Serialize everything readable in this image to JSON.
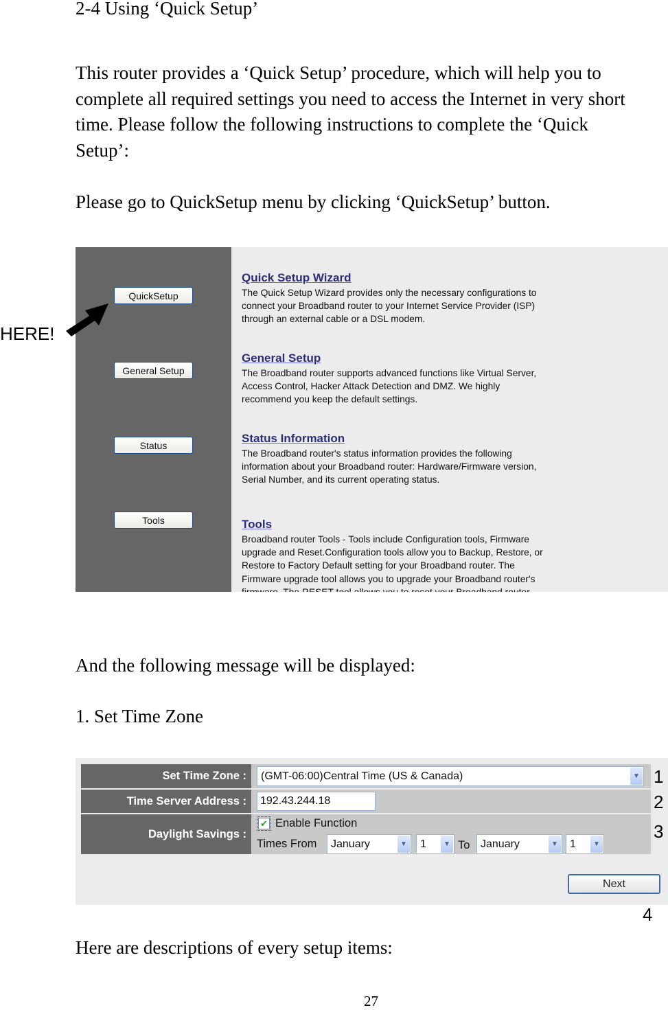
{
  "document": {
    "heading": "2-4 Using ‘Quick Setup’",
    "intro_lines": [
      "This router provides a ‘Quick Setup’ procedure, which will help you to",
      "complete all required settings you need to access the Internet in very short",
      "time. Please follow the following instructions to complete the ‘Quick",
      "Setup’:"
    ],
    "instruction": "Please go to QuickSetup menu by clicking ‘QuickSetup’ button.",
    "message_intro": "And the following message will be displayed:",
    "step_title": "1. Set Time Zone",
    "descriptions_intro": "Here are descriptions of every setup items:",
    "page_number": "27"
  },
  "annotation": {
    "here_label": "HERE!",
    "markers": [
      "1",
      "2",
      "3",
      "4"
    ]
  },
  "router_menu": {
    "sidebar_buttons": [
      {
        "label": "QuickSetup"
      },
      {
        "label": "General Setup"
      },
      {
        "label": "Status"
      },
      {
        "label": "Tools"
      }
    ],
    "sections": [
      {
        "title": "Quick Setup Wizard",
        "body": "The Quick Setup Wizard provides only the necessary configurations to\nconnect your Broadband router to your Internet Service Provider (ISP)\nthrough an external cable or a DSL modem."
      },
      {
        "title": "General Setup",
        "body": "The Broadband router supports advanced functions like Virtual Server,\nAccess Control, Hacker Attack Detection and DMZ. We highly\nrecommend you keep the default settings."
      },
      {
        "title": "Status Information",
        "body": "The Broadband router's status information provides the following\ninformation about your Broadband router: Hardware/Firmware version,\nSerial Number, and its current operating status."
      },
      {
        "title": "Tools",
        "body": "Broadband router Tools - Tools include Configuration tools, Firmware\nupgrade and Reset.Configuration tools allow you to Backup, Restore, or\nRestore to Factory Default setting for your Broadband router. The\nFirmware upgrade tool allows you to upgrade your Broadband router's\nfirmware. The RESET tool allows you to reset your Broadband router."
      }
    ]
  },
  "time_zone_form": {
    "set_time_zone_label": "Set Time Zone :",
    "set_time_zone_value": "(GMT-06:00)Central Time (US & Canada)",
    "time_server_label": "Time Server Address :",
    "time_server_value": "192.43.244.18",
    "daylight_label": "Daylight Savings :",
    "enable_function_label": "Enable Function",
    "enable_function_checked": true,
    "times_from_label": "Times From",
    "from_month": "January",
    "from_day": "1",
    "to_label": "To",
    "to_month": "January",
    "to_day": "1",
    "next_label": "Next"
  }
}
